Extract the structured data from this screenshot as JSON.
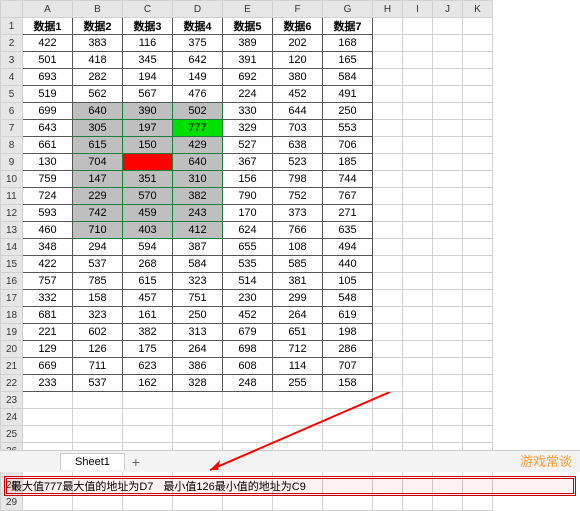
{
  "cols": [
    "A",
    "B",
    "C",
    "D",
    "E",
    "F",
    "G",
    "H",
    "I",
    "J",
    "K"
  ],
  "headers": [
    "数据1",
    "数据2",
    "数据3",
    "数据4",
    "数据5",
    "数据6",
    "数据7"
  ],
  "rows": [
    [
      "422",
      "383",
      "116",
      "375",
      "389",
      "202",
      "168"
    ],
    [
      "501",
      "418",
      "345",
      "642",
      "391",
      "120",
      "165"
    ],
    [
      "693",
      "282",
      "194",
      "149",
      "692",
      "380",
      "584"
    ],
    [
      "519",
      "562",
      "567",
      "476",
      "224",
      "452",
      "491"
    ],
    [
      "699",
      "640",
      "390",
      "502",
      "330",
      "644",
      "250"
    ],
    [
      "643",
      "305",
      "197",
      "777",
      "329",
      "703",
      "553"
    ],
    [
      "661",
      "615",
      "150",
      "429",
      "527",
      "638",
      "706"
    ],
    [
      "130",
      "704",
      "",
      "640",
      "367",
      "523",
      "185"
    ],
    [
      "759",
      "147",
      "351",
      "310",
      "156",
      "798",
      "744"
    ],
    [
      "724",
      "229",
      "570",
      "382",
      "790",
      "752",
      "767"
    ],
    [
      "593",
      "742",
      "459",
      "243",
      "170",
      "373",
      "271"
    ],
    [
      "460",
      "710",
      "403",
      "412",
      "624",
      "766",
      "635"
    ],
    [
      "348",
      "294",
      "594",
      "387",
      "655",
      "108",
      "494"
    ],
    [
      "422",
      "537",
      "268",
      "584",
      "535",
      "585",
      "440"
    ],
    [
      "757",
      "785",
      "615",
      "323",
      "514",
      "381",
      "105"
    ],
    [
      "332",
      "158",
      "457",
      "751",
      "230",
      "299",
      "548"
    ],
    [
      "681",
      "323",
      "161",
      "250",
      "452",
      "264",
      "619"
    ],
    [
      "221",
      "602",
      "382",
      "313",
      "679",
      "651",
      "198"
    ],
    [
      "129",
      "126",
      "175",
      "264",
      "698",
      "712",
      "286"
    ],
    [
      "669",
      "711",
      "623",
      "386",
      "608",
      "114",
      "707"
    ],
    [
      "233",
      "537",
      "162",
      "328",
      "248",
      "255",
      "158"
    ]
  ],
  "tab": "Sheet1",
  "addtab": "+",
  "status1": "最大值777最大值的地址为D7",
  "status2": "最小值126最小值的地址为C9",
  "watermark": "游戏常谈",
  "chart_data": {
    "type": "table",
    "title": "数据1–数据7",
    "annotations": {
      "max_value": 777,
      "max_cell": "D7",
      "min_value": 126,
      "min_cell": "C9",
      "highlight_green": "D7",
      "highlight_red": "C9",
      "selection_range": "B6:D13"
    }
  }
}
